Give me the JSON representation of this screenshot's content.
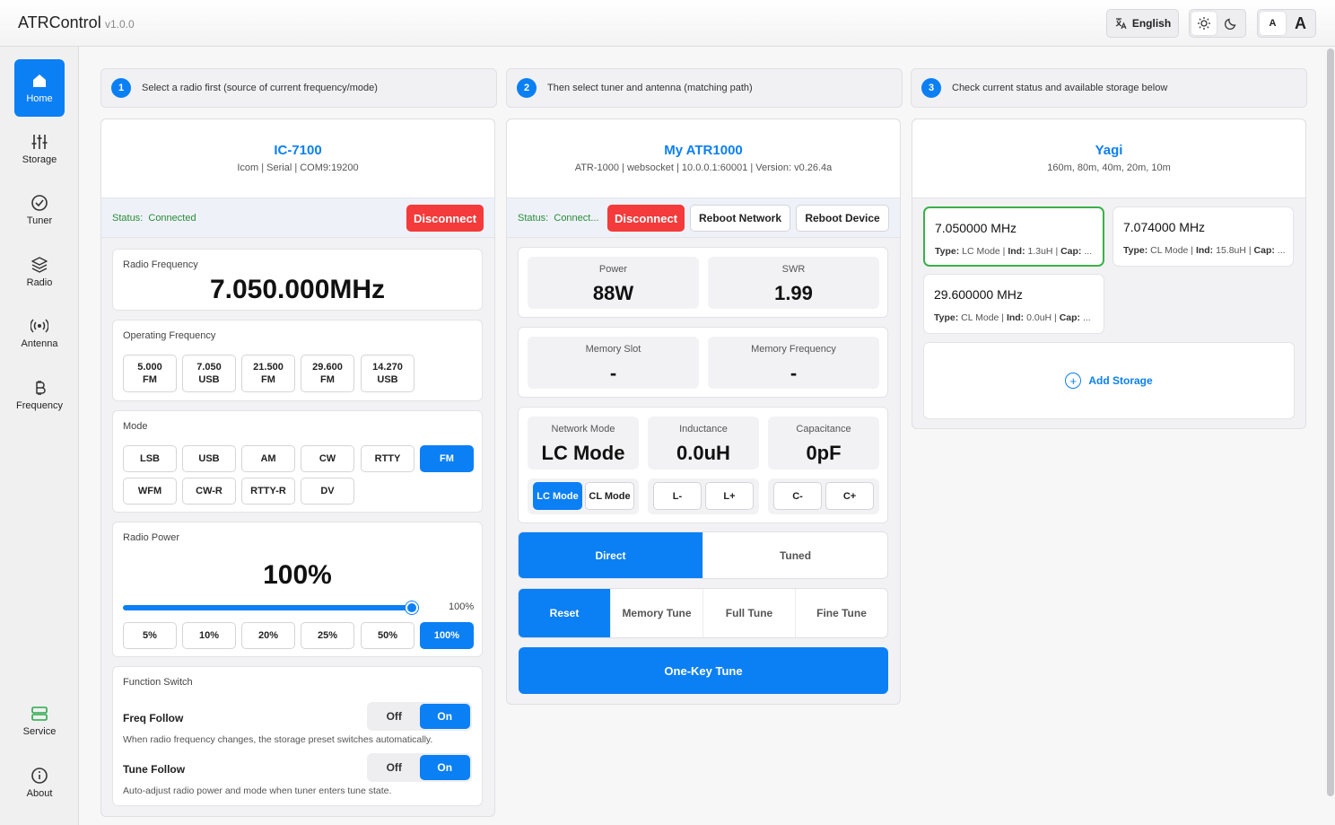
{
  "header": {
    "title": "ATRControl",
    "version": "v1.0.0",
    "language": "English",
    "font_small": "A",
    "font_large": "A"
  },
  "sidebar": {
    "items": [
      {
        "label": "Home",
        "icon": "home-icon"
      },
      {
        "label": "Storage",
        "icon": "sliders-icon"
      },
      {
        "label": "Tuner",
        "icon": "check-circle-icon"
      },
      {
        "label": "Radio",
        "icon": "layers-icon"
      },
      {
        "label": "Antenna",
        "icon": "broadcast-icon"
      },
      {
        "label": "Frequency",
        "icon": "bitcoin-icon"
      }
    ],
    "service": "Service",
    "about": "About"
  },
  "steps": [
    {
      "num": "1",
      "text": "Select a radio first (source of current frequency/mode)"
    },
    {
      "num": "2",
      "text": "Then select tuner and antenna (matching path)"
    },
    {
      "num": "3",
      "text": "Check current status and available storage below"
    }
  ],
  "radio": {
    "name": "IC-7100",
    "details": "Icom | Serial | COM9:19200",
    "status_label": "Status:",
    "status_value": "Connected",
    "disconnect": "Disconnect",
    "freq_label": "Radio Frequency",
    "freq_value": "7.050.000MHz",
    "op_label": "Operating Frequency",
    "op_freqs": [
      {
        "freq": "5.000",
        "mode": "FM"
      },
      {
        "freq": "7.050",
        "mode": "USB"
      },
      {
        "freq": "21.500",
        "mode": "FM"
      },
      {
        "freq": "29.600",
        "mode": "FM"
      },
      {
        "freq": "14.270",
        "mode": "USB"
      }
    ],
    "mode_label": "Mode",
    "modes": [
      "LSB",
      "USB",
      "AM",
      "CW",
      "RTTY",
      "FM",
      "WFM",
      "CW-R",
      "RTTY-R",
      "DV"
    ],
    "active_mode": "FM",
    "power_label": "Radio Power",
    "power_value": "100%",
    "power_level": 1.0,
    "power_slider_text": "100%",
    "power_presets": [
      "5%",
      "10%",
      "20%",
      "25%",
      "50%",
      "100%"
    ],
    "fs_label": "Function Switch",
    "freq_follow": "Freq Follow",
    "freq_follow_desc": "When radio frequency changes, the storage preset switches automatically.",
    "tune_follow": "Tune Follow",
    "tune_follow_desc": "Auto-adjust radio power and mode when tuner enters tune state.",
    "off": "Off",
    "on": "On"
  },
  "tuner": {
    "name": "My ATR1000",
    "details": "ATR-1000 | websocket | 10.0.0.1:60001 | Version: v0.26.4a",
    "status_label": "Status:",
    "status_value": "Connect...",
    "disconnect": "Disconnect",
    "reboot_network": "Reboot Network",
    "reboot_device": "Reboot Device",
    "power_label": "Power",
    "power_value": "88W",
    "swr_label": "SWR",
    "swr_value": "1.99",
    "mem_slot_label": "Memory Slot",
    "mem_slot_value": "-",
    "mem_freq_label": "Memory Frequency",
    "mem_freq_value": "-",
    "net_mode_label": "Network Mode",
    "net_mode_value": "LC Mode",
    "ind_label": "Inductance",
    "ind_value": "0.0uH",
    "cap_label": "Capacitance",
    "cap_value": "0pF",
    "lc_mode": "LC Mode",
    "cl_mode": "CL Mode",
    "l_minus": "L-",
    "l_plus": "L+",
    "c_minus": "C-",
    "c_plus": "C+",
    "direct": "Direct",
    "tuned": "Tuned",
    "reset": "Reset",
    "memory_tune": "Memory Tune",
    "full_tune": "Full Tune",
    "fine_tune": "Fine Tune",
    "one_key": "One-Key Tune"
  },
  "antenna": {
    "name": "Yagi",
    "bands": "160m, 80m, 40m, 20m, 10m",
    "storage": [
      {
        "freq": "7.050000 MHz",
        "type": "LC Mode",
        "ind": "1.3uH",
        "cap": "..."
      },
      {
        "freq": "7.074000 MHz",
        "type": "CL Mode",
        "ind": "15.8uH",
        "cap": "..."
      },
      {
        "freq": "29.600000 MHz",
        "type": "CL Mode",
        "ind": "0.0uH",
        "cap": "..."
      }
    ],
    "type_label": "Type:",
    "ind_label": "Ind:",
    "cap_label": "Cap:",
    "add_storage": "Add Storage"
  }
}
